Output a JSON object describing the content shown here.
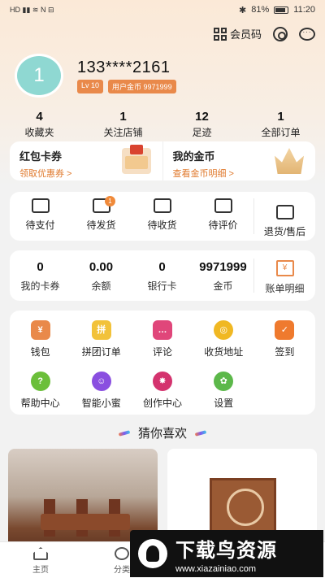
{
  "status": {
    "left_indicators": "HD ▮▮ ≋ N ⊟",
    "battery": "81%",
    "time": "11:20",
    "bluetooth": "✱"
  },
  "header": {
    "member_code_label": "会员码"
  },
  "user": {
    "avatar_text": "1",
    "name": "133****2161",
    "level": "Lv 10",
    "coins_badge": "用户金币 9971999"
  },
  "stats": [
    {
      "value": "4",
      "label": "收藏夹"
    },
    {
      "value": "1",
      "label": "关注店铺"
    },
    {
      "value": "12",
      "label": "足迹"
    },
    {
      "value": "1",
      "label": "全部订单"
    }
  ],
  "promo": {
    "coupon_title": "红包卡券",
    "coupon_sub": "领取优惠券 >",
    "coins_title": "我的金币",
    "coins_sub": "查看金币明细 >"
  },
  "orders": [
    {
      "label": "待支付",
      "icon": "wallet-icon"
    },
    {
      "label": "待发货",
      "icon": "box-icon",
      "badge": "1"
    },
    {
      "label": "待收货",
      "icon": "truck-icon"
    },
    {
      "label": "待评价",
      "icon": "comment-icon"
    },
    {
      "label": "退货/售后",
      "icon": "list-icon"
    }
  ],
  "wallet": [
    {
      "value": "0",
      "label": "我的卡券"
    },
    {
      "value": "0.00",
      "label": "余额"
    },
    {
      "value": "0",
      "label": "银行卡"
    },
    {
      "value": "9971999",
      "label": "金币"
    }
  ],
  "bill": {
    "label": "账单明细",
    "icon_text": "¥"
  },
  "services": [
    {
      "label": "钱包",
      "color": "#e9894a",
      "glyph": "¥",
      "icon": "wallet-icon"
    },
    {
      "label": "拼团订单",
      "color": "#f2c23a",
      "glyph": "拼",
      "icon": "group-order-icon"
    },
    {
      "label": "评论",
      "color": "#e0467a",
      "glyph": "…",
      "icon": "comment-icon"
    },
    {
      "label": "收货地址",
      "color": "#f0b823",
      "glyph": "◎",
      "icon": "location-icon"
    },
    {
      "label": "签到",
      "color": "#ef7a2e",
      "glyph": "✓",
      "icon": "calendar-icon"
    },
    {
      "label": "帮助中心",
      "color": "#6bbf3a",
      "glyph": "?",
      "icon": "help-icon"
    },
    {
      "label": "智能小蜜",
      "color": "#8a4fe0",
      "glyph": "☺",
      "icon": "assistant-icon"
    },
    {
      "label": "创作中心",
      "color": "#d4336e",
      "glyph": "✸",
      "icon": "aperture-icon"
    },
    {
      "label": "设置",
      "color": "#5cb84a",
      "glyph": "✿",
      "icon": "flower-gear-icon"
    }
  ],
  "guess_title": "猜你喜欢",
  "tabs": [
    {
      "label": "主页"
    },
    {
      "label": "分类"
    }
  ],
  "watermark": {
    "title": "下载鸟资源",
    "url": "www.xiazainiao.com"
  }
}
